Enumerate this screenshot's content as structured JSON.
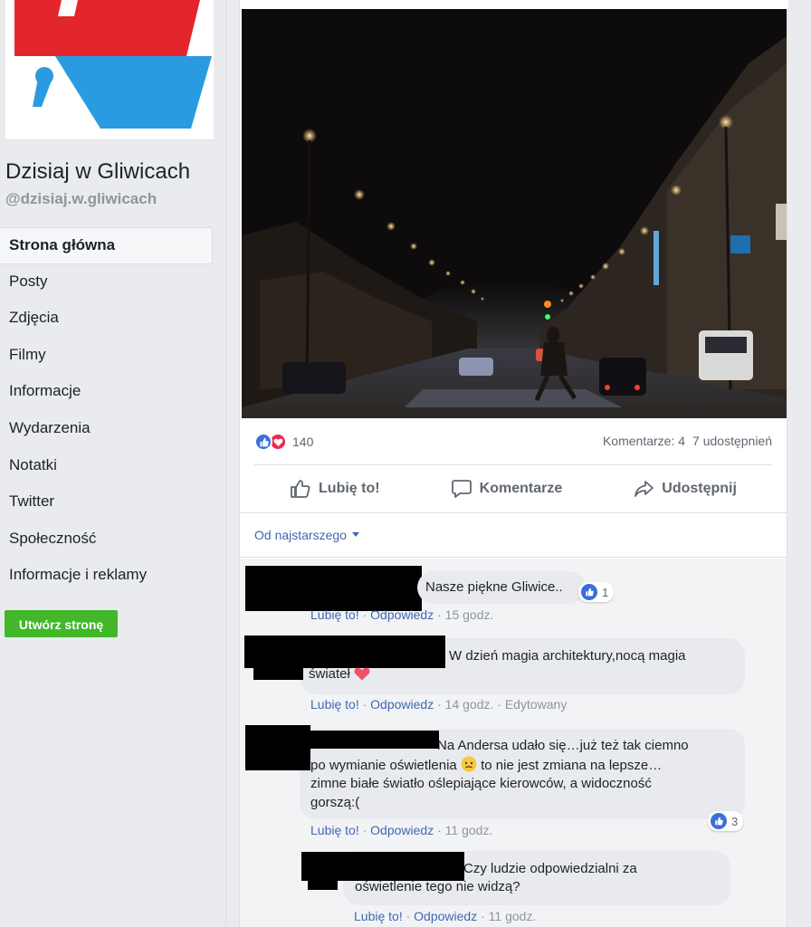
{
  "page": {
    "name": "Dzisiaj w Gliwicach",
    "handle": "@dzisiaj.w.gliwicach",
    "logo_colors": {
      "red": "#e3262c",
      "blue": "#2a9be0"
    }
  },
  "sidebar": {
    "items": [
      {
        "label": "Strona główna",
        "active": true
      },
      {
        "label": "Posty"
      },
      {
        "label": "Zdjęcia"
      },
      {
        "label": "Filmy"
      },
      {
        "label": "Informacje"
      },
      {
        "label": "Wydarzenia"
      },
      {
        "label": "Notatki"
      },
      {
        "label": "Twitter"
      },
      {
        "label": "Społeczność"
      },
      {
        "label": "Informacje i reklamy"
      }
    ],
    "create_button": "Utwórz stronę"
  },
  "post": {
    "reaction_count": "140",
    "reaction_icons": [
      "like-icon",
      "love-icon"
    ],
    "comments_stat": "Komentarze: 4",
    "shares_stat": "7 udostępnień",
    "actions": {
      "like": "Lubię to!",
      "comment": "Komentarze",
      "share": "Udostępnij"
    }
  },
  "comments_sort": "Od najstarszego",
  "comments": [
    {
      "text": "Nasze piękne Gliwice..",
      "likes": "1",
      "like": "Lubię to!",
      "reply": "Odpowiedz",
      "time": "15 godz.",
      "edited": ""
    },
    {
      "text_line1": "W dzień magia architektury,nocą magia",
      "text_line2": "świateł",
      "emoji": "heart",
      "like": "Lubię to!",
      "reply": "Odpowiedz",
      "time": "14 godz.",
      "edited": "Edytowany"
    },
    {
      "text_line1": "Na Andersa udało się…już też tak ciemno",
      "text_line2a": "po wymianie oświetlenia",
      "text_line2b": "to nie jest zmiana na lepsze…",
      "text_line3": "zimne białe światło oślepiające kierowców, a widoczność",
      "text_line4": "gorszą:(",
      "emoji": "worried-face",
      "likes": "3",
      "like": "Lubię to!",
      "reply": "Odpowiedz",
      "time": "11 godz."
    },
    {
      "text_line1": "Czy ludzie odpowiedzialni za",
      "text_line2": "oświetlenie tego nie widzą?",
      "like": "Lubię to!",
      "reply": "Odpowiedz",
      "time": "11 godz."
    }
  ],
  "separator": "·"
}
